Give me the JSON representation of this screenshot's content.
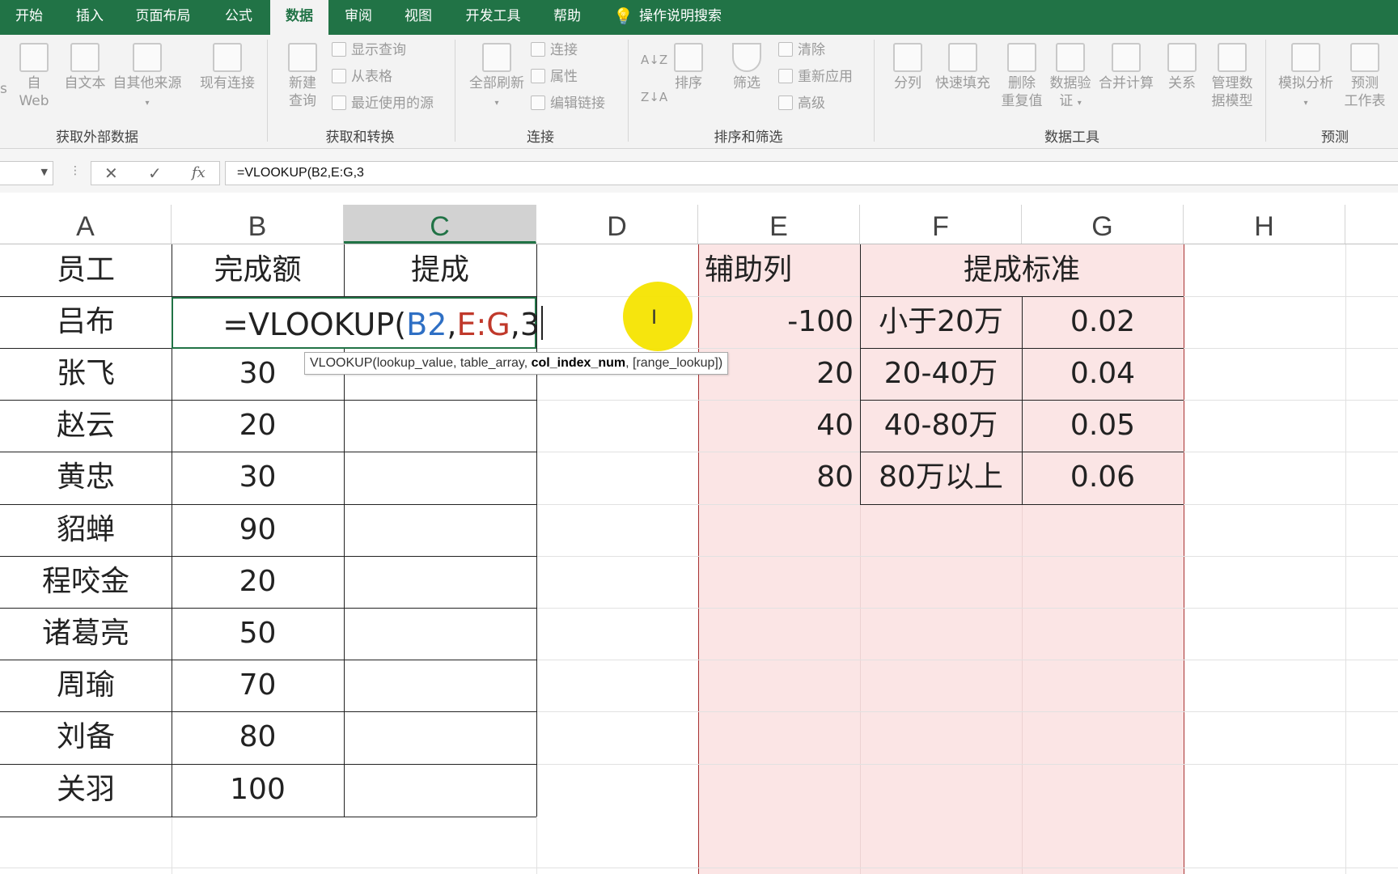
{
  "tabs": [
    "开始",
    "插入",
    "页面布局",
    "公式",
    "数据",
    "审阅",
    "视图",
    "开发工具",
    "帮助"
  ],
  "active_tab": "数据",
  "search_label": "操作说明搜索",
  "ribbon": {
    "external": {
      "label": "获取外部数据",
      "web": [
        "自",
        "Web"
      ],
      "text": "自文本",
      "other": "自其他来源",
      "existing": "现有连接",
      "cut_left": "s"
    },
    "transform": {
      "label": "获取和转换",
      "newquery": [
        "新建",
        "查询"
      ],
      "show_queries": "显示查询",
      "from_table": "从表格",
      "recent_sources": "最近使用的源"
    },
    "connections": {
      "label": "连接",
      "refresh_all": "全部刷新",
      "connections": "连接",
      "properties": "属性",
      "edit_links": "编辑链接"
    },
    "sortfilter": {
      "label": "排序和筛选",
      "sort": "排序",
      "filter": "筛选",
      "clear": "清除",
      "reapply": "重新应用",
      "advanced": "高级"
    },
    "datatools": {
      "label": "数据工具",
      "split": "分列",
      "flash_fill": "快速填充",
      "remove_dup": [
        "删除",
        "重复值"
      ],
      "validation": [
        "数据验",
        "证"
      ],
      "consolidate": "合并计算",
      "relationships": "关系",
      "manage_model": [
        "管理数",
        "据模型"
      ]
    },
    "forecast": {
      "label": "预测",
      "whatif": "模拟分析",
      "forecast_sheet": [
        "预测",
        "工作表"
      ]
    }
  },
  "formula_bar": {
    "cancel": "✕",
    "enter": "✓",
    "fx": "fx",
    "content": "=VLOOKUP(B2,E:G,3"
  },
  "columns": [
    "A",
    "B",
    "C",
    "D",
    "E",
    "F",
    "G",
    "H"
  ],
  "selected_column": "C",
  "table_headers": {
    "employee": "员工",
    "amount": "完成额",
    "commission": "提成",
    "helper": "辅助列",
    "standard": "提成标准"
  },
  "employees": [
    {
      "name": "吕布",
      "amount": ""
    },
    {
      "name": "张飞",
      "amount": "30"
    },
    {
      "name": "赵云",
      "amount": "20"
    },
    {
      "name": "黄忠",
      "amount": "30"
    },
    {
      "name": "貂蝉",
      "amount": "90"
    },
    {
      "name": "程咬金",
      "amount": "20"
    },
    {
      "name": "诸葛亮",
      "amount": "50"
    },
    {
      "name": "周瑜",
      "amount": "70"
    },
    {
      "name": "刘备",
      "amount": "80"
    },
    {
      "name": "关羽",
      "amount": "100"
    }
  ],
  "standards": [
    {
      "helper": "-100",
      "range": "小于20万",
      "rate": "0.02"
    },
    {
      "helper": "20",
      "range": "20-40万",
      "rate": "0.04"
    },
    {
      "helper": "40",
      "range": "40-80万",
      "rate": "0.05"
    },
    {
      "helper": "80",
      "range": "80万以上",
      "rate": "0.06"
    }
  ],
  "edit": {
    "prefix": "=VLOOKUP(",
    "ref1": "B2",
    "comma1": ",",
    "ref2": "E:G",
    "rest": ",3"
  },
  "tooltip": {
    "fn": "VLOOKUP(lookup_value, table_array, ",
    "bold": "col_index_num",
    "tail": ", [range_lookup])"
  },
  "colors": {
    "excel_green": "#217346",
    "highlight_pink": "#fbe5e5",
    "ref_blue": "#2e6fc4",
    "ref_red": "#c0392b",
    "cursor_yellow": "#f5e400"
  }
}
